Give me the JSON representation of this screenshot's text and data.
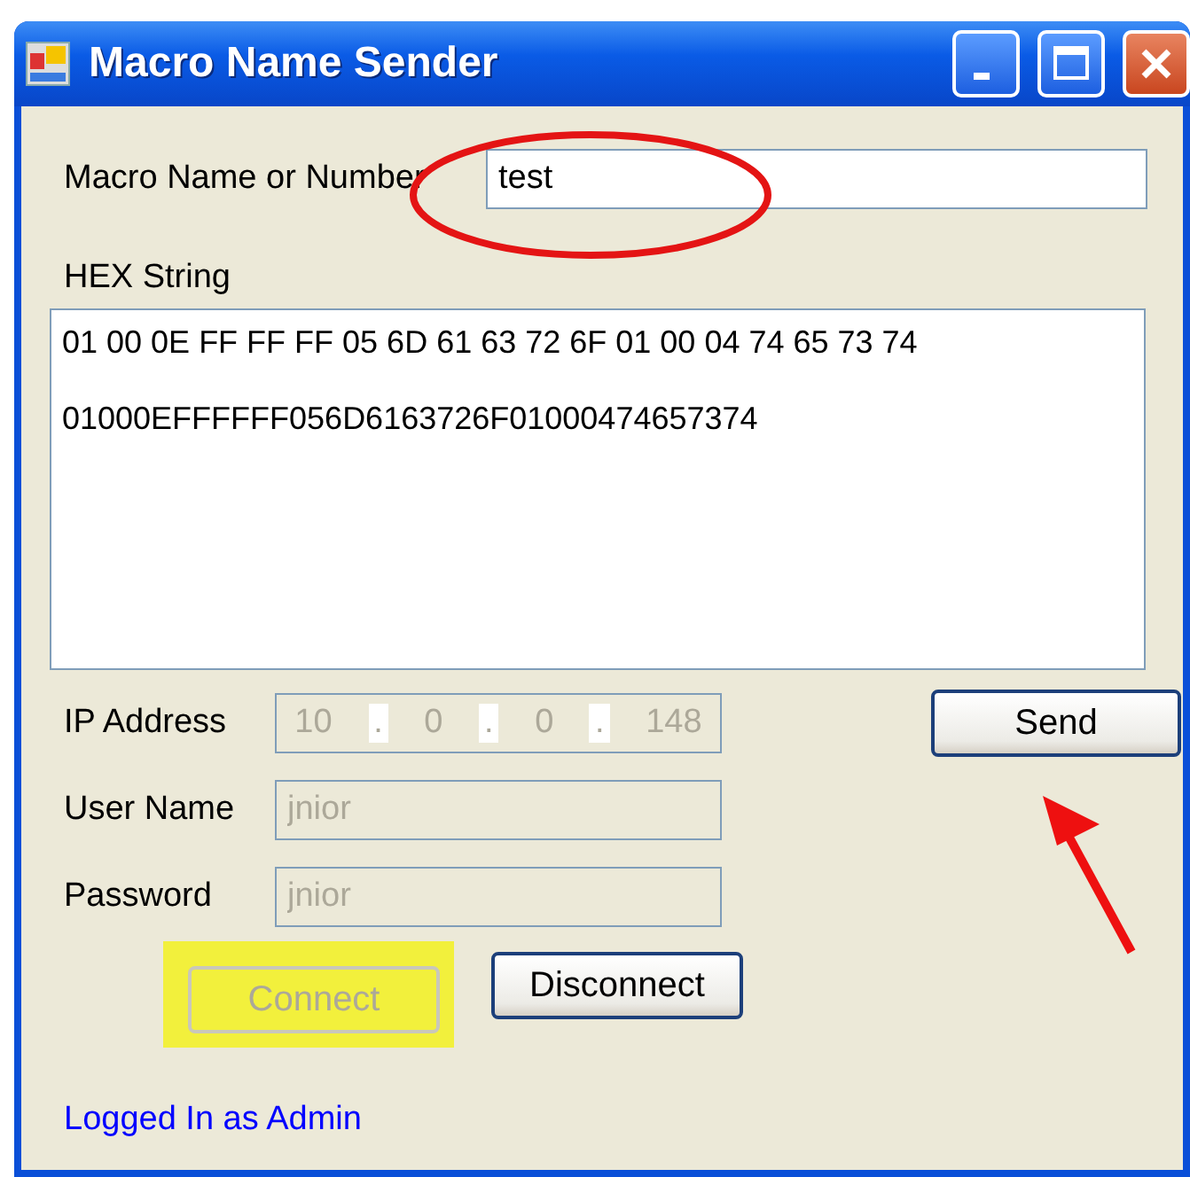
{
  "window": {
    "title": "Macro Name Sender"
  },
  "macro": {
    "label": "Macro Name or Number",
    "value": "test"
  },
  "hex": {
    "label": "HEX String",
    "lines": [
      "01 00 0E FF FF FF 05 6D 61 63 72 6F 01 00 04 74 65 73 74",
      "01000EFFFFFF056D6163726F01000474657374"
    ]
  },
  "ip_address": {
    "label": "IP Address",
    "octets": [
      "10",
      "0",
      "0",
      "148"
    ],
    "separator": ".",
    "disabled": true
  },
  "user_name": {
    "label": "User Name",
    "value": "jnior",
    "disabled": true
  },
  "password": {
    "label": "Password",
    "value": "jnior",
    "disabled": true
  },
  "buttons": [
    {
      "kind": "send",
      "label": "Send",
      "disabled": false,
      "highlighted": false
    },
    {
      "kind": "connect",
      "label": "Connect",
      "disabled": true,
      "highlighted": true
    },
    {
      "kind": "disconnect",
      "label": "Disconnect",
      "disabled": false,
      "highlighted": false
    }
  ],
  "status": "Logged In as Admin"
}
